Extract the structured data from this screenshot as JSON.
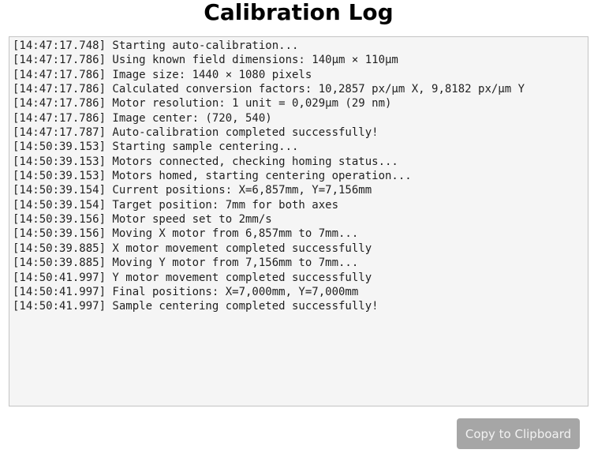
{
  "title": "Calibration Log",
  "log_lines": [
    "[14:47:17.748] Starting auto-calibration...",
    "[14:47:17.786] Using known field dimensions: 140µm × 110µm",
    "[14:47:17.786] Image size: 1440 × 1080 pixels",
    "[14:47:17.786] Calculated conversion factors: 10,2857 px/µm X, 9,8182 px/µm Y",
    "[14:47:17.786] Motor resolution: 1 unit = 0,029µm (29 nm)",
    "[14:47:17.786] Image center: (720, 540)",
    "[14:47:17.787] Auto-calibration completed successfully!",
    "[14:50:39.153] Starting sample centering...",
    "[14:50:39.153] Motors connected, checking homing status...",
    "[14:50:39.153] Motors homed, starting centering operation...",
    "[14:50:39.154] Current positions: X=6,857mm, Y=7,156mm",
    "[14:50:39.154] Target position: 7mm for both axes",
    "[14:50:39.156] Motor speed set to 2mm/s",
    "[14:50:39.156] Moving X motor from 6,857mm to 7mm...",
    "[14:50:39.885] X motor movement completed successfully",
    "[14:50:39.885] Moving Y motor from 7,156mm to 7mm...",
    "[14:50:41.997] Y motor movement completed successfully",
    "[14:50:41.997] Final positions: X=7,000mm, Y=7,000mm",
    "[14:50:41.997] Sample centering completed successfully!"
  ],
  "copy_button_label": "Copy to Clipboard",
  "colors": {
    "log_background": "#f5f5f5",
    "log_border": "#c4c4c4",
    "button_background": "#a6a6a6",
    "button_text": "#f2f2f2"
  }
}
